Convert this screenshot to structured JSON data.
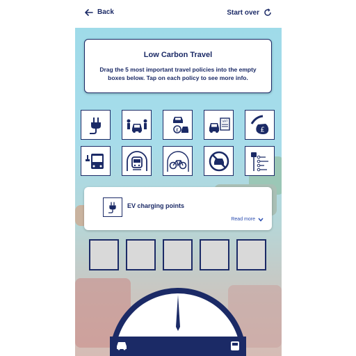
{
  "topbar": {
    "back_label": "Back",
    "start_over_label": "Start over"
  },
  "intro": {
    "title": "Low Carbon Travel",
    "instructions": "Drag the 5 most important travel policies into the empty boxes below. Tap on each policy to see more info."
  },
  "policies": [
    {
      "icon": "ev-plug-icon"
    },
    {
      "icon": "car-sharing-icon"
    },
    {
      "icon": "congestion-charge-icon"
    },
    {
      "icon": "car-vat-icon"
    },
    {
      "icon": "money-bag-icon"
    },
    {
      "icon": "electric-bus-icon"
    },
    {
      "icon": "train-tunnel-icon"
    },
    {
      "icon": "cycle-lane-icon"
    },
    {
      "icon": "no-cars-icon"
    },
    {
      "icon": "bus-route-icon"
    }
  ],
  "info": {
    "title": "EV charging points",
    "read_more": "Read more"
  },
  "slots_count": 5,
  "colors": {
    "primary": "#1b2a66",
    "link": "#2b4db0",
    "slot_fill": "#d9d9d9"
  }
}
